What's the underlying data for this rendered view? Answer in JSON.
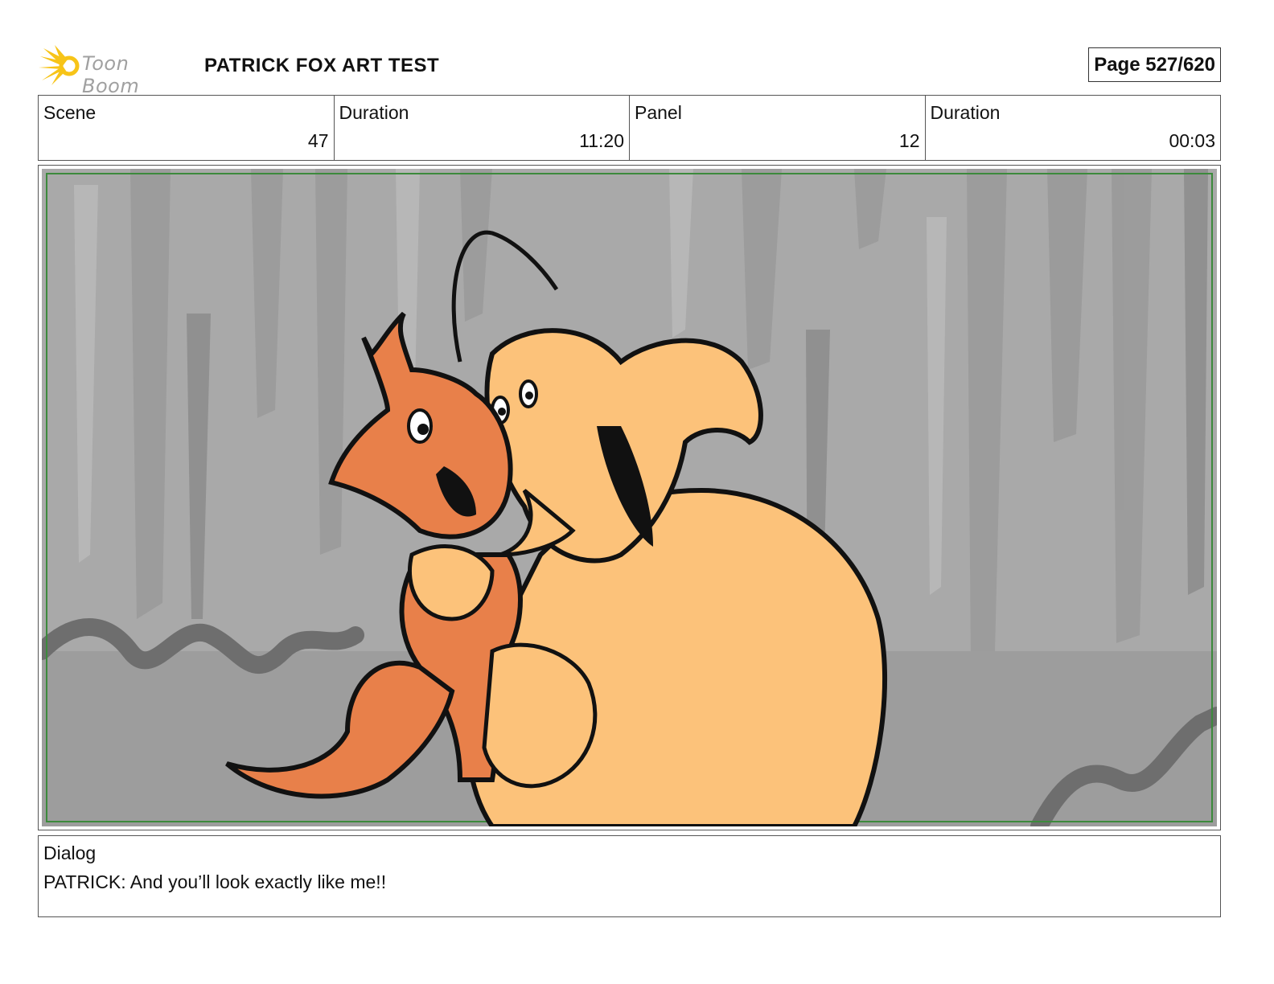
{
  "header": {
    "logo_text": "Toon Boom",
    "logo_icon": "sunburst-logo-icon",
    "title": "PATRICK FOX ART TEST",
    "page_label": "Page 527/620"
  },
  "info": {
    "scene_label": "Scene",
    "scene_value": "47",
    "scene_duration_label": "Duration",
    "scene_duration_value": "11:20",
    "panel_label": "Panel",
    "panel_value": "12",
    "panel_duration_label": "Duration",
    "panel_duration_value": "00:03"
  },
  "dialog": {
    "label": "Dialog",
    "text": "PATRICK: And you’ll look exactly like me!!"
  },
  "colors": {
    "fox_orange": "#e8804a",
    "character_tan": "#fcc27a",
    "background_gray": "#a9a9a9",
    "safe_frame_green": "#3c8a3c",
    "logo_yellow": "#f7c418"
  }
}
